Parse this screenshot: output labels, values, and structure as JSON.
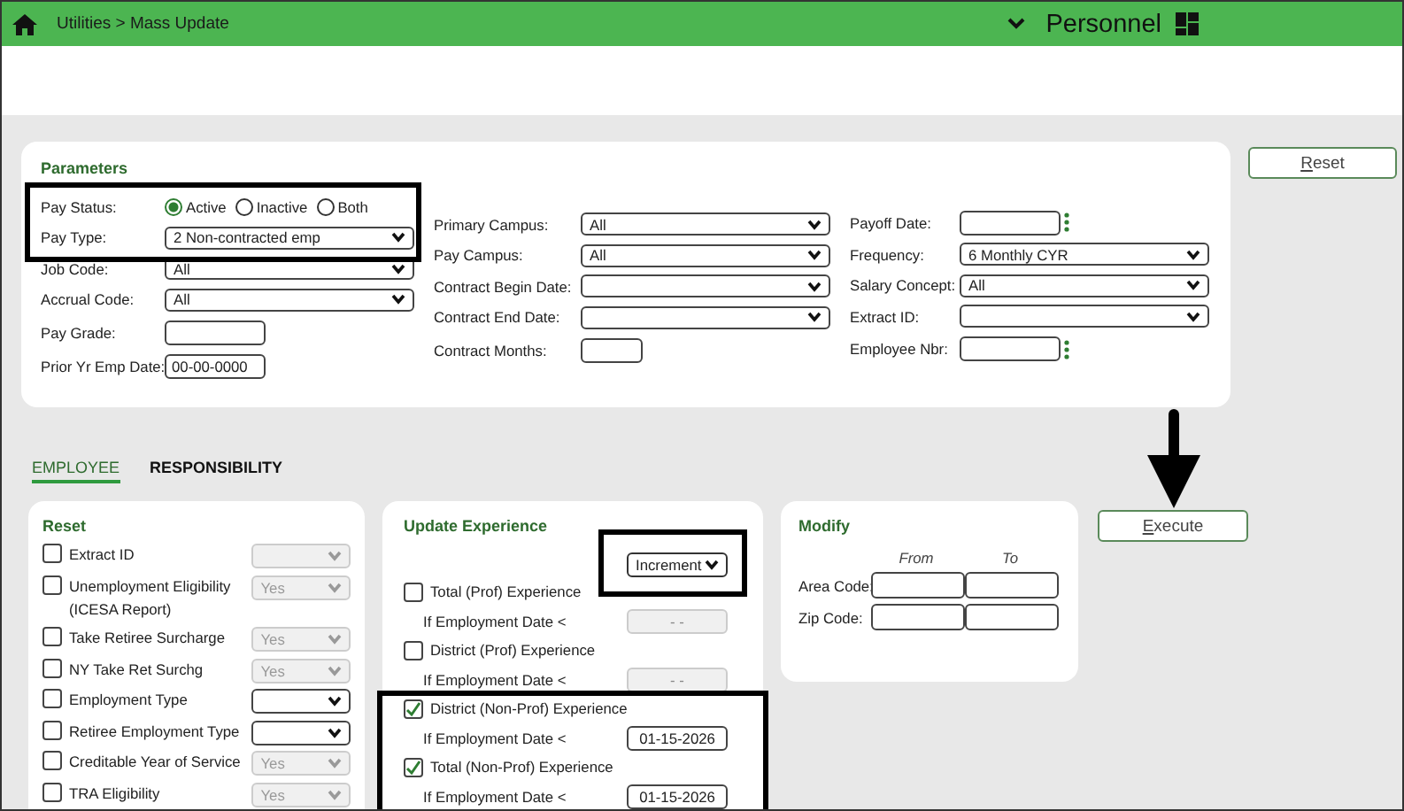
{
  "header": {
    "breadcrumb": "Utilities > Mass Update",
    "module": "Personnel"
  },
  "parameters": {
    "title": "Parameters",
    "pay_status": {
      "label": "Pay Status:",
      "options": [
        {
          "label": "Active",
          "selected": true
        },
        {
          "label": "Inactive",
          "selected": false
        },
        {
          "label": "Both",
          "selected": false
        }
      ]
    },
    "columns": [
      [
        {
          "label": "Pay Type:",
          "kind": "select",
          "value": "2 Non-contracted emp"
        },
        {
          "label": "Job Code:",
          "kind": "select",
          "value": "All"
        },
        {
          "label": "Accrual Code:",
          "kind": "select",
          "value": "All"
        },
        {
          "label": "Pay Grade:",
          "kind": "input"
        },
        {
          "label": "Prior Yr Emp Date:",
          "kind": "input",
          "value": "00-00-0000"
        }
      ],
      [
        {
          "label": "Primary Campus:",
          "kind": "select",
          "value": "All"
        },
        {
          "label": "Pay Campus:",
          "kind": "select",
          "value": "All"
        },
        {
          "label": "Contract Begin Date:",
          "kind": "select"
        },
        {
          "label": "Contract End Date:",
          "kind": "select"
        },
        {
          "label": "Contract Months:",
          "kind": "short"
        }
      ],
      [
        {
          "label": "Payoff Date:",
          "kind": "lookup"
        },
        {
          "label": "Frequency:",
          "kind": "select",
          "value": "6 Monthly CYR"
        },
        {
          "label": "Salary Concept:",
          "kind": "select",
          "value": "All"
        },
        {
          "label": "Extract ID:",
          "kind": "select"
        },
        {
          "label": "Employee Nbr:",
          "kind": "lookup"
        }
      ]
    ]
  },
  "reset_button": "Reset",
  "tabs": [
    {
      "label": "EMPLOYEE",
      "selected": true
    },
    {
      "label": "RESPONSIBILITY",
      "selected": false
    }
  ],
  "reset_section": {
    "title": "Reset",
    "items": [
      {
        "label": "Extract ID",
        "checked": false,
        "disabled": true
      },
      {
        "label": "Unemployment Eligibility (ICESA Report)",
        "checked": false,
        "value": "Yes",
        "disabled": true
      },
      {
        "label": "Take Retiree Surcharge",
        "checked": false,
        "value": "Yes",
        "disabled": true
      },
      {
        "label": "NY Take Ret Surchg",
        "checked": false,
        "value": "Yes",
        "disabled": true
      },
      {
        "label": "Employment Type",
        "checked": false,
        "disabled": false
      },
      {
        "label": "Retiree Employment Type",
        "checked": false,
        "disabled": false
      },
      {
        "label": "Creditable Year of Service",
        "checked": false,
        "value": "Yes",
        "disabled": true
      },
      {
        "label": "TRA Eligibility",
        "checked": false,
        "value": "Yes",
        "disabled": true
      }
    ]
  },
  "update_experience": {
    "title": "Update Experience",
    "mode": "Increment",
    "items": [
      {
        "label": "Total (Prof) Experience",
        "checked": false,
        "date_label": "If Employment Date <",
        "date": "- -",
        "disabled": true
      },
      {
        "label": "District (Prof) Experience",
        "checked": false,
        "date_label": "If Employment Date <",
        "date": "- -",
        "disabled": true
      },
      {
        "label": "District (Non-Prof) Experience",
        "checked": true,
        "date_label": "If Employment Date <",
        "date": "01-15-2026",
        "disabled": false
      },
      {
        "label": "Total (Non-Prof) Experience",
        "checked": true,
        "date_label": "If Employment Date <",
        "date": "01-15-2026",
        "disabled": false
      }
    ]
  },
  "modify": {
    "title": "Modify",
    "columns": [
      "From",
      "To"
    ],
    "rows": [
      {
        "label": "Area Code:"
      },
      {
        "label": "Zip Code:"
      }
    ]
  },
  "execute_button": "Execute"
}
